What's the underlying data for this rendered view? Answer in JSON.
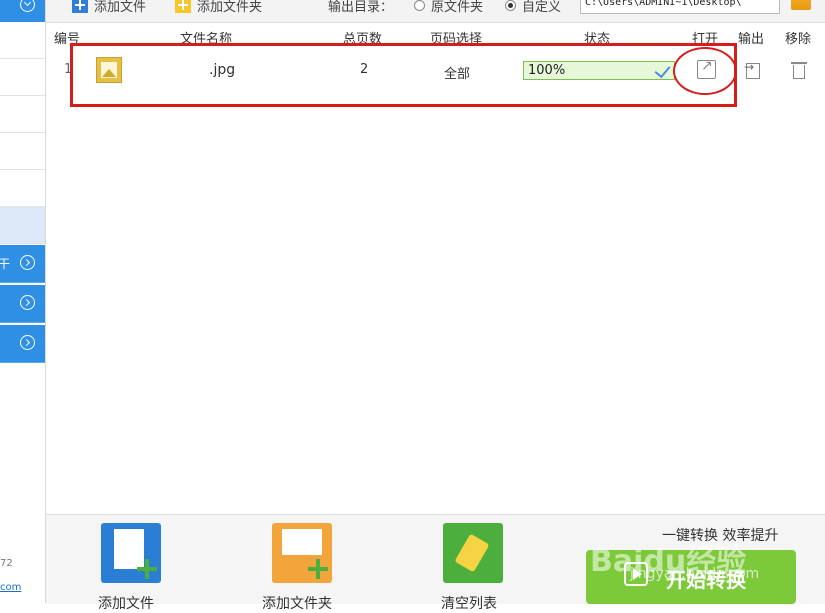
{
  "sidebar": {
    "top_text": "",
    "items": [
      "",
      "",
      "",
      "",
      ""
    ],
    "blue_items": [
      {
        "text": "干"
      },
      {
        "text": ""
      },
      {
        "text": ""
      }
    ],
    "footer_number": "72",
    "footer_link": "com"
  },
  "toolbar": {
    "add_file_label": "添加文件",
    "add_folder_label": "添加文件夹",
    "output_dir_label": "输出目录：",
    "option_original_label": "原文件夹",
    "option_custom_label": "自定义",
    "selected_option": "自定义",
    "output_path": "C:\\Users\\ADMINI~1\\Desktop\\"
  },
  "table": {
    "headers": {
      "index": "编号",
      "file_name": "文件名称",
      "total_pages": "总页数",
      "page_select": "页码选择",
      "status": "状态",
      "open": "打开",
      "export": "输出",
      "remove": "移除"
    },
    "rows": [
      {
        "index": "1",
        "file_name": ".jpg",
        "total_pages": "2",
        "page_select": "全部",
        "progress_percent": 100,
        "progress_label": "100%"
      }
    ]
  },
  "bottom": {
    "add_file_label": "添加文件",
    "add_folder_label": "添加文件夹",
    "clear_list_label": "清空列表",
    "slogan": "一键转换 效率提升",
    "start_button_label": "开始转换"
  },
  "watermark": {
    "text": "Baidu经验",
    "sub": "jingyan.baidu.com"
  },
  "colors": {
    "accent_blue": "#2f8fe5",
    "success_green": "#7cc93a",
    "annotation_red": "#d81c1c"
  }
}
